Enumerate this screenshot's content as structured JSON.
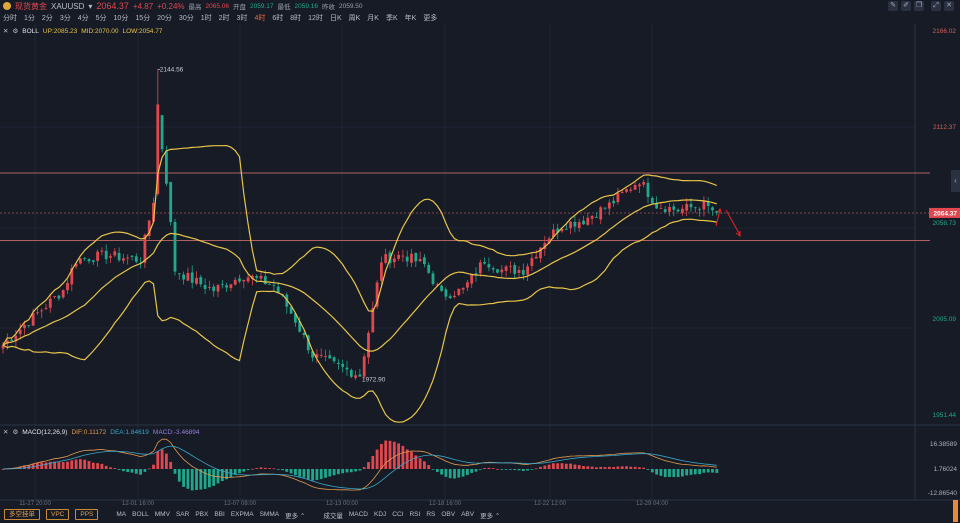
{
  "header": {
    "name": "现货黄金",
    "symbol": "XAUUSD",
    "price": "2064.37",
    "change": "+4.87",
    "change_pct": "+0.24%",
    "high_label": "最高",
    "high": "2065.06",
    "open_label": "开盘",
    "open": "2059.17",
    "low_label": "最低",
    "low": "2059.16",
    "prev_label": "昨收",
    "prev": "2059.50"
  },
  "periods": [
    "分时",
    "1分",
    "2分",
    "3分",
    "4分",
    "5分",
    "10分",
    "15分",
    "20分",
    "30分",
    "1时",
    "2时",
    "3时",
    "4时",
    "6时",
    "8时",
    "12时",
    "日K",
    "周K",
    "月K",
    "季K",
    "年K",
    "更多"
  ],
  "active_period": "4时",
  "tools": [
    "draw-icon",
    "pen-icon",
    "layers-icon",
    "expand-icon",
    "fullscreen-icon"
  ],
  "boll": {
    "label": "BOLL",
    "up": "UP:2085.23",
    "mid": "MID:2070.00",
    "low": "LOW:2054.77"
  },
  "macd": {
    "label": "MACD(12,26,9)",
    "dif": "DIF:0.11172",
    "dea": "DEA:1.84619",
    "macd": "MACD:-3.46894"
  },
  "price_axis": [
    "2166.02",
    "2112.37",
    "2058.73",
    "2005.09",
    "1951.44"
  ],
  "current_price_tag": "2064.37",
  "macd_axis": [
    "16.38589",
    "1.76024",
    "-12.86540"
  ],
  "time_labels": [
    "11-27 20:00",
    "12-01 16:00",
    "12-07 08:00",
    "12-13 00:00",
    "12-18 16:00",
    "12-22 12:00",
    "12-29 04:00"
  ],
  "annotations": {
    "high": "2144.56",
    "low": "1972.90"
  },
  "bottom": {
    "buttons": [
      "多空挂单",
      "VPC",
      "PPS"
    ],
    "main_ind": [
      "MA",
      "BOLL",
      "MMV",
      "SAR",
      "PBX",
      "BBI",
      "EXPMA",
      "SMMA",
      "更多 ⌃"
    ],
    "sub_ind": [
      "成交量",
      "MACD",
      "KDJ",
      "CCI",
      "RSI",
      "RS",
      "OBV",
      "ABV",
      "更多 ⌃"
    ]
  },
  "colors": {
    "up": "#e2474f",
    "down": "#1fa88c",
    "boll": "#e7c44a",
    "dif": "#e39a4e",
    "dea": "#3aa5c8",
    "bg": "#161b26"
  },
  "chart_data": {
    "type": "candlestick",
    "title": "XAUUSD 4H",
    "ylim": [
      1951.44,
      2166.02
    ],
    "horizontal_lines": [
      2086.7,
      2049.0
    ],
    "key_closes": [
      1990.6,
      2001.8,
      2021.3,
      2038.1,
      2040.9,
      2038.1,
      2071.6,
      2119.1,
      2082.8,
      2032.5,
      2026.9,
      2021.3,
      2029.7,
      2024.1,
      2004.5,
      1985.0,
      1979.4,
      1973.8,
      2010.1,
      2038.1,
      2040.9,
      2035.3,
      2018.5,
      2021.3,
      2038.1,
      2032.5,
      2032.5,
      2049.2,
      2057.6,
      2060.4,
      2068.8,
      2082.8,
      2068.8,
      2066.0,
      2068.8,
      2064.37
    ],
    "key_x_index": [
      0,
      5,
      14,
      17,
      24,
      32,
      35,
      36,
      38,
      40,
      44,
      49,
      56,
      63,
      68,
      72,
      77,
      83,
      86,
      88,
      93,
      98,
      102,
      107,
      112,
      116,
      121,
      126,
      130,
      135,
      141,
      148,
      152,
      157,
      163,
      166
    ]
  }
}
